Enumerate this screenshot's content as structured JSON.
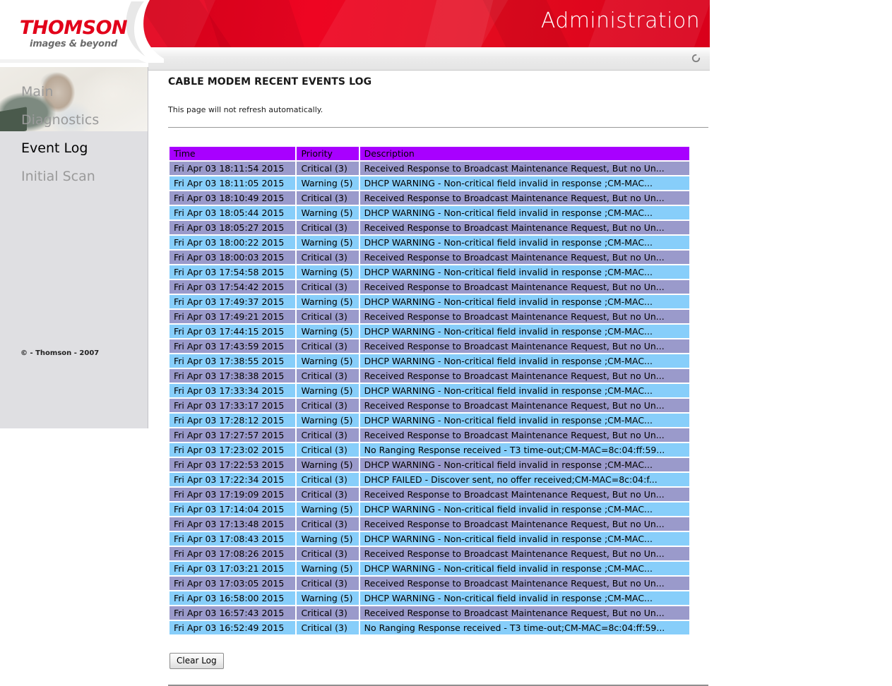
{
  "brand": {
    "logo_name": "THOMSON",
    "logo_tagline": "images & beyond"
  },
  "header": {
    "section_title": "Administration",
    "refresh_icon": "refresh-spinner-icon"
  },
  "sidebar": {
    "items": [
      {
        "label": "Main",
        "active": false
      },
      {
        "label": "Diagnostics",
        "active": false
      },
      {
        "label": "Event Log",
        "active": true
      },
      {
        "label": "Initial Scan",
        "active": false
      }
    ],
    "copyright": "© - Thomson - 2007"
  },
  "main": {
    "title": "CABLE MODEM RECENT EVENTS LOG",
    "note": "This page will not refresh automatically.",
    "clear_log_label": "Clear Log"
  },
  "table": {
    "header_color": "#a800ff",
    "row_color_even": "#9a9acb",
    "row_color_odd": "#87cefa",
    "columns": [
      "Time",
      "Priority",
      "Description"
    ],
    "rows": [
      [
        "Fri Apr 03 18:11:54 2015",
        "Critical (3)",
        "Received Response to Broadcast Maintenance Request, But no Un..."
      ],
      [
        "Fri Apr 03 18:11:05 2015",
        "Warning (5)",
        "DHCP WARNING - Non-critical field invalid in response ;CM-MAC..."
      ],
      [
        "Fri Apr 03 18:10:49 2015",
        "Critical (3)",
        "Received Response to Broadcast Maintenance Request, But no Un..."
      ],
      [
        "Fri Apr 03 18:05:44 2015",
        "Warning (5)",
        "DHCP WARNING - Non-critical field invalid in response ;CM-MAC..."
      ],
      [
        "Fri Apr 03 18:05:27 2015",
        "Critical (3)",
        "Received Response to Broadcast Maintenance Request, But no Un..."
      ],
      [
        "Fri Apr 03 18:00:22 2015",
        "Warning (5)",
        "DHCP WARNING - Non-critical field invalid in response ;CM-MAC..."
      ],
      [
        "Fri Apr 03 18:00:03 2015",
        "Critical (3)",
        "Received Response to Broadcast Maintenance Request, But no Un..."
      ],
      [
        "Fri Apr 03 17:54:58 2015",
        "Warning (5)",
        "DHCP WARNING - Non-critical field invalid in response ;CM-MAC..."
      ],
      [
        "Fri Apr 03 17:54:42 2015",
        "Critical (3)",
        "Received Response to Broadcast Maintenance Request, But no Un..."
      ],
      [
        "Fri Apr 03 17:49:37 2015",
        "Warning (5)",
        "DHCP WARNING - Non-critical field invalid in response ;CM-MAC..."
      ],
      [
        "Fri Apr 03 17:49:21 2015",
        "Critical (3)",
        "Received Response to Broadcast Maintenance Request, But no Un..."
      ],
      [
        "Fri Apr 03 17:44:15 2015",
        "Warning (5)",
        "DHCP WARNING - Non-critical field invalid in response ;CM-MAC..."
      ],
      [
        "Fri Apr 03 17:43:59 2015",
        "Critical (3)",
        "Received Response to Broadcast Maintenance Request, But no Un..."
      ],
      [
        "Fri Apr 03 17:38:55 2015",
        "Warning (5)",
        "DHCP WARNING - Non-critical field invalid in response ;CM-MAC..."
      ],
      [
        "Fri Apr 03 17:38:38 2015",
        "Critical (3)",
        "Received Response to Broadcast Maintenance Request, But no Un..."
      ],
      [
        "Fri Apr 03 17:33:34 2015",
        "Warning (5)",
        "DHCP WARNING - Non-critical field invalid in response ;CM-MAC..."
      ],
      [
        "Fri Apr 03 17:33:17 2015",
        "Critical (3)",
        "Received Response to Broadcast Maintenance Request, But no Un..."
      ],
      [
        "Fri Apr 03 17:28:12 2015",
        "Warning (5)",
        "DHCP WARNING - Non-critical field invalid in response ;CM-MAC..."
      ],
      [
        "Fri Apr 03 17:27:57 2015",
        "Critical (3)",
        "Received Response to Broadcast Maintenance Request, But no Un..."
      ],
      [
        "Fri Apr 03 17:23:02 2015",
        "Critical (3)",
        "No Ranging Response received - T3 time-out;CM-MAC=8c:04:ff:59..."
      ],
      [
        "Fri Apr 03 17:22:53 2015",
        "Warning (5)",
        "DHCP WARNING - Non-critical field invalid in response ;CM-MAC..."
      ],
      [
        "Fri Apr 03 17:22:34 2015",
        "Critical (3)",
        "DHCP FAILED - Discover sent, no offer received;CM-MAC=8c:04:f..."
      ],
      [
        "Fri Apr 03 17:19:09 2015",
        "Critical (3)",
        "Received Response to Broadcast Maintenance Request, But no Un..."
      ],
      [
        "Fri Apr 03 17:14:04 2015",
        "Warning (5)",
        "DHCP WARNING - Non-critical field invalid in response ;CM-MAC..."
      ],
      [
        "Fri Apr 03 17:13:48 2015",
        "Critical (3)",
        "Received Response to Broadcast Maintenance Request, But no Un..."
      ],
      [
        "Fri Apr 03 17:08:43 2015",
        "Warning (5)",
        "DHCP WARNING - Non-critical field invalid in response ;CM-MAC..."
      ],
      [
        "Fri Apr 03 17:08:26 2015",
        "Critical (3)",
        "Received Response to Broadcast Maintenance Request, But no Un..."
      ],
      [
        "Fri Apr 03 17:03:21 2015",
        "Warning (5)",
        "DHCP WARNING - Non-critical field invalid in response ;CM-MAC..."
      ],
      [
        "Fri Apr 03 17:03:05 2015",
        "Critical (3)",
        "Received Response to Broadcast Maintenance Request, But no Un..."
      ],
      [
        "Fri Apr 03 16:58:00 2015",
        "Warning (5)",
        "DHCP WARNING - Non-critical field invalid in response ;CM-MAC..."
      ],
      [
        "Fri Apr 03 16:57:43 2015",
        "Critical (3)",
        "Received Response to Broadcast Maintenance Request, But no Un..."
      ],
      [
        "Fri Apr 03 16:52:49 2015",
        "Critical (3)",
        "No Ranging Response received - T3 time-out;CM-MAC=8c:04:ff:59..."
      ]
    ]
  }
}
